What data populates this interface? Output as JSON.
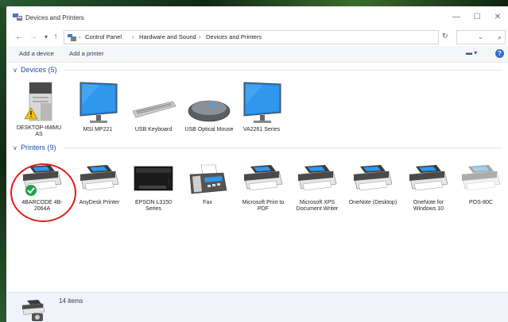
{
  "window": {
    "title": "Devices and Printers"
  },
  "titlebar": {
    "min": "—",
    "max": "☐",
    "close": "✕"
  },
  "nav": {
    "back": "←",
    "forward": "→",
    "recent": "▾",
    "up": "↑"
  },
  "breadcrumb": [
    "Control Panel",
    "Hardware and Sound",
    "Devices and Printers"
  ],
  "breadcrumb_sep": "›",
  "address": {
    "dropdown": "⌄",
    "refresh": "↻"
  },
  "search": {
    "placeholder": "",
    "icon": "⌕"
  },
  "commands": {
    "add_device": "Add a device",
    "add_printer": "Add a printer"
  },
  "viewbtn": "▬ ▾",
  "help": "?",
  "devices_group": {
    "chev": "∨",
    "label": "Devices (5)"
  },
  "devices": [
    {
      "label": "DESKTOP-I68MU AS",
      "icon": "computer-tower-icon"
    },
    {
      "label": "MSI MP221",
      "icon": "monitor-icon"
    },
    {
      "label": "USB Keyboard",
      "icon": "keyboard-icon"
    },
    {
      "label": "USB Optical Mouse",
      "icon": "mouse-icon"
    },
    {
      "label": "VA2261 Series",
      "icon": "monitor-icon"
    }
  ],
  "printers_group": {
    "chev": "∨",
    "label": "Printers (9)"
  },
  "printers": [
    {
      "label": "4BARCODE 4B-2064A",
      "icon": "printer-icon",
      "default": true
    },
    {
      "label": "AnyDesk Printer",
      "icon": "printer-icon"
    },
    {
      "label": "EPSON L3150 Series",
      "icon": "inkjet-printer-icon"
    },
    {
      "label": "Fax",
      "icon": "fax-icon"
    },
    {
      "label": "Microsoft Print to PDF",
      "icon": "printer-icon"
    },
    {
      "label": "Microsoft XPS Document Writer",
      "icon": "printer-icon"
    },
    {
      "label": "OneNote (Desktop)",
      "icon": "printer-icon"
    },
    {
      "label": "OneNote for Windows 10",
      "icon": "printer-icon"
    },
    {
      "label": "POS-80C",
      "icon": "printer-icon",
      "faded": true
    }
  ],
  "status": {
    "text": "14 items"
  },
  "colors": {
    "accent": "#1e4fa0",
    "selection": "#e01a1a",
    "default_check": "#1ea44a"
  }
}
